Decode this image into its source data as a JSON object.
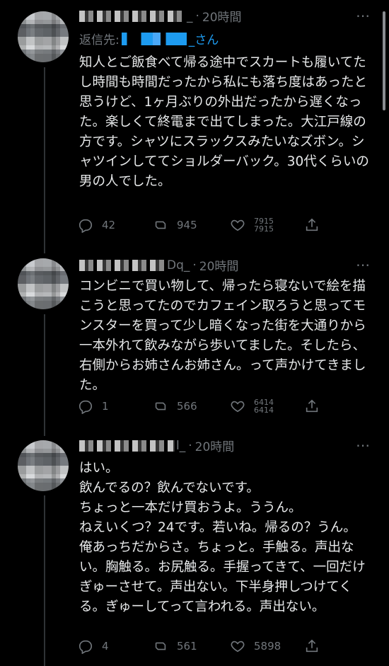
{
  "tweets": [
    {
      "handle_tail": "_",
      "time": "20時間",
      "reply_label": "返信先:",
      "reply_tail": "_さん",
      "text": "知人とご飯食べて帰る途中でスカートも履いてたし時間も時間だったから私にも落ち度はあったと思うけど、1ヶ月ぶりの外出だったから遅くなった。楽しくて終電まで出てしまった。大江戸線の方です。シャツにスラックスみたいなズボン。シャツインしててショルダーバック。30代くらいの男の人でした。",
      "replies": "42",
      "retweets": "945",
      "likes_top": "7915",
      "likes_bottom": "7915"
    },
    {
      "handle_tail": "Dq_",
      "time": "20時間",
      "text": "コンビニで買い物して、帰ったら寝ないで絵を描こうと思ってたのでカフェイン取ろうと思ってモンスターを買って少し暗くなった街を大通りから一本外れて飲みながら歩いてました。そしたら、右側からお姉さんお姉さん。って声かけてきました。",
      "replies": "1",
      "retweets": "566",
      "likes_top": "6414",
      "likes_bottom": "6414"
    },
    {
      "handle_tail": "l_",
      "time": "20時間",
      "text": "はい。\n飲んでるの？飲んでないです。\nちょっと一本だけ買おうよ。ううん。\nねえいくつ？24です。若いね。帰るの？うん。俺あっちだからさ。ちょっと。手触る。声出ない。胸触る。お尻触る。手握ってきて、一回だけぎゅーさせて。声出ない。下半身押しつけてくる。ぎゅーしてって言われる。声出ない。",
      "replies": "4",
      "retweets": "561",
      "likes": "5898"
    }
  ],
  "icons": [
    "reply-icon",
    "retweet-icon",
    "like-icon",
    "share-icon",
    "more-icon"
  ]
}
